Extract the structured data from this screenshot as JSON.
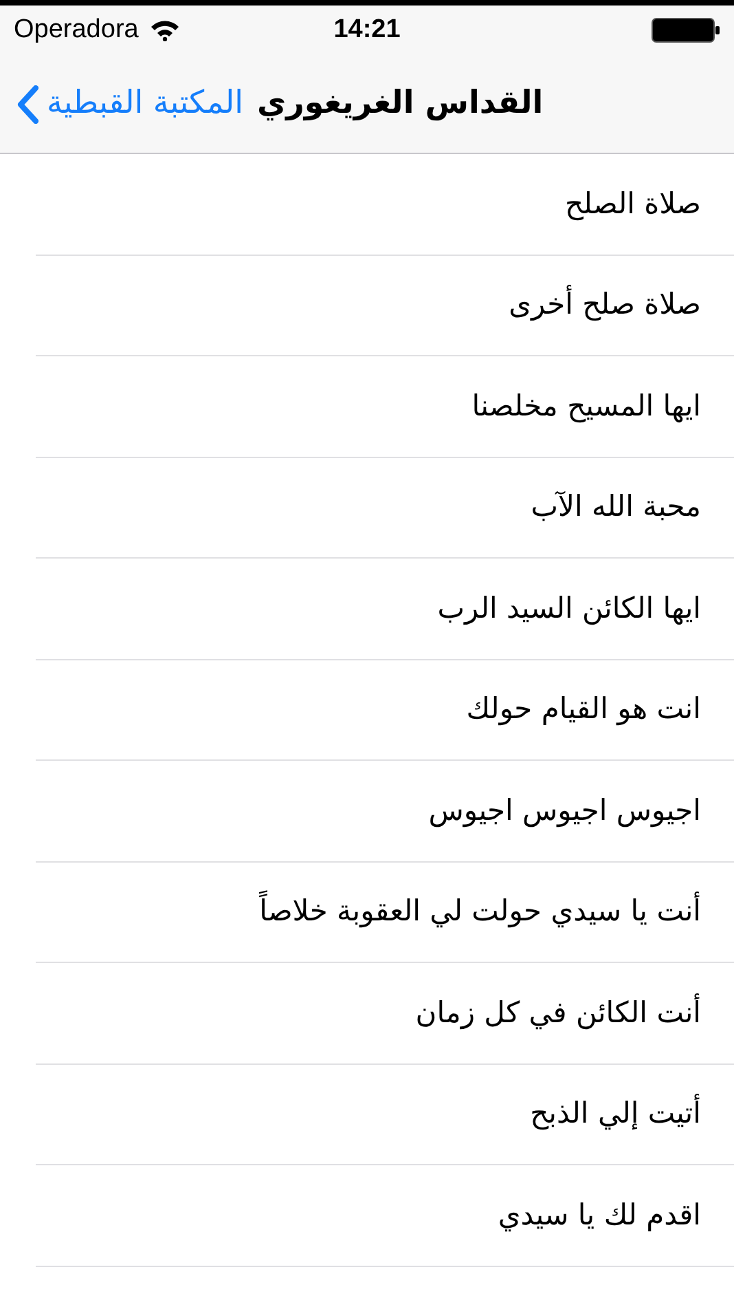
{
  "status_bar": {
    "carrier": "Operadora",
    "time": "14:21"
  },
  "nav_bar": {
    "back": "المكتبة القبطية",
    "title": "القداس الغريغوري"
  },
  "items": [
    {
      "label": "صلاة الصلح"
    },
    {
      "label": "صلاة صلح أخرى"
    },
    {
      "label": "ايها المسيح مخلصنا"
    },
    {
      "label": "محبة الله الآب"
    },
    {
      "label": "ايها الكائن السيد الرب"
    },
    {
      "label": "انت هو القيام حولك"
    },
    {
      "label": "اجيوس اجيوس اجيوس"
    },
    {
      "label": "أنت يا سيدي حولت لي العقوبة خلاصاً"
    },
    {
      "label": "أنت الكائن في كل زمان"
    },
    {
      "label": "أتيت إلي الذبح"
    },
    {
      "label": "اقدم لك يا سيدي"
    }
  ]
}
